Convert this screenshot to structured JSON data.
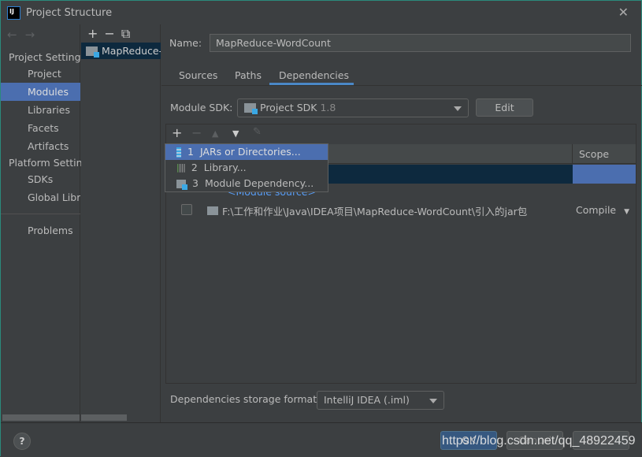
{
  "window": {
    "title": "Project Structure",
    "close_icon": "close-icon"
  },
  "sidebar": {
    "project_settings": "Project Settings",
    "platform_settings": "Platform Settings",
    "items": [
      {
        "label": "Project"
      },
      {
        "label": "Modules",
        "selected": true
      },
      {
        "label": "Libraries"
      },
      {
        "label": "Facets"
      },
      {
        "label": "Artifacts"
      },
      {
        "label": "SDKs"
      },
      {
        "label": "Global Libraries"
      },
      {
        "label": "Problems"
      }
    ]
  },
  "modules": {
    "add": "+",
    "remove": "−",
    "copy": "⧉",
    "items": [
      {
        "label": "MapReduce-WordCount"
      }
    ]
  },
  "main": {
    "name_label": "Name:",
    "name_value": "MapReduce-WordCount",
    "tabs": [
      {
        "label": "Sources"
      },
      {
        "label": "Paths"
      },
      {
        "label": "Dependencies",
        "selected": true
      }
    ],
    "sdk_label": "Module SDK:",
    "sdk_value": "Project SDK",
    "sdk_version": "1.8",
    "edit": "Edit",
    "deps": {
      "scope_header": "Scope",
      "rows": [
        {
          "label": "",
          "scope": ""
        },
        {
          "label": "<Module source>",
          "scope": ""
        },
        {
          "label": "F:\\工作和作业\\Java\\IDEA项目\\MapReduce-WordCount\\引入的jar包",
          "scope": "Compile",
          "checked": false
        }
      ]
    },
    "popup": [
      {
        "num": "1",
        "label": "JARs or Directories...",
        "icon": "jar-icon"
      },
      {
        "num": "2",
        "label": "Library...",
        "icon": "library-icon"
      },
      {
        "num": "3",
        "label": "Module Dependency...",
        "icon": "module-icon"
      }
    ],
    "format_label": "Dependencies storage format:",
    "format_value": "IntelliJ IDEA (.iml)"
  },
  "bottom": {
    "help": "?",
    "ok": "OK",
    "cancel": "Cancel",
    "apply": "Apply",
    "watermark": "https://blog.csdn.net/qq_48922459"
  }
}
